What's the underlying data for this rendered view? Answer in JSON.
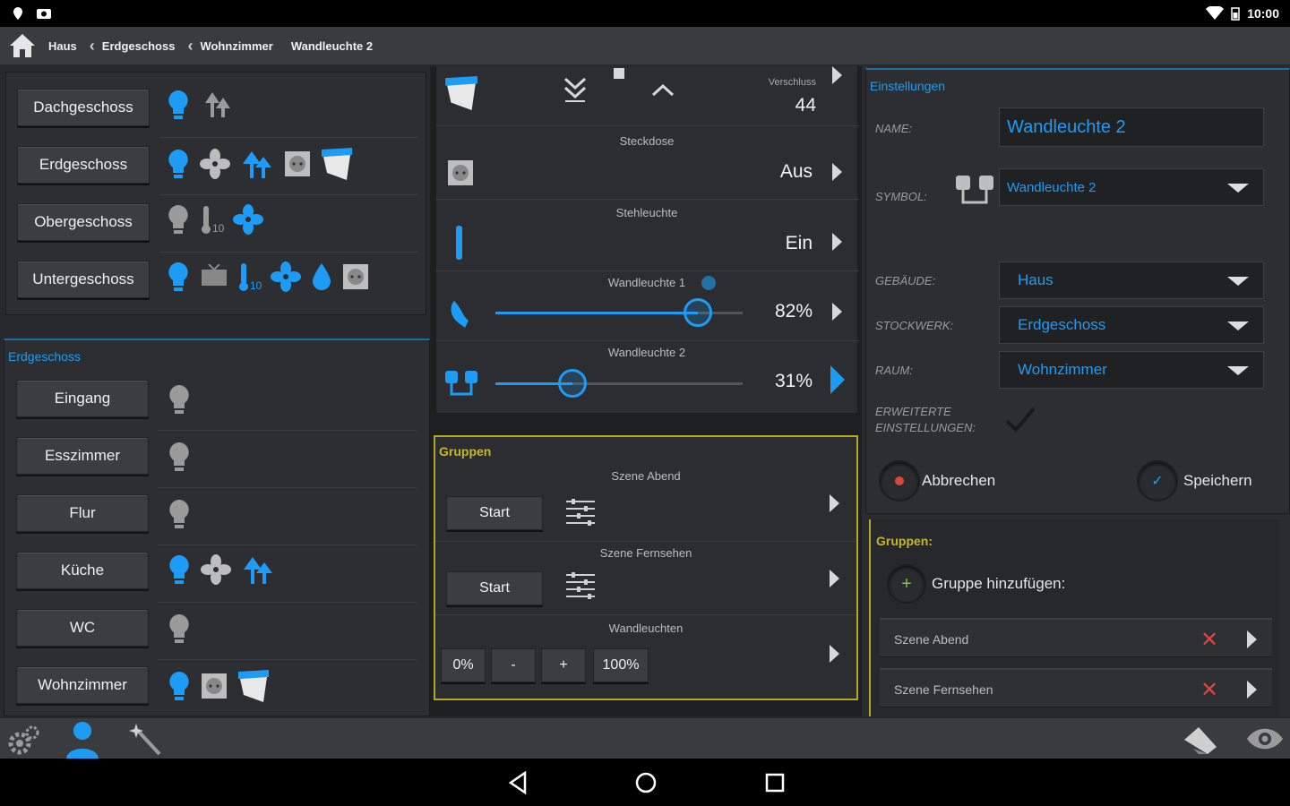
{
  "status": {
    "time": "10:00"
  },
  "breadcrumb": [
    "Haus",
    "Erdgeschoss",
    "Wohnzimmer",
    "Wandleuchte 2"
  ],
  "floors": [
    {
      "label": "Dachgeschoss"
    },
    {
      "label": "Erdgeschoss"
    },
    {
      "label": "Obergeschoss",
      "temp": "10"
    },
    {
      "label": "Untergeschoss",
      "temp": "10"
    }
  ],
  "rooms_title": "Erdgeschoss",
  "rooms": [
    {
      "label": "Eingang"
    },
    {
      "label": "Esszimmer"
    },
    {
      "label": "Flur"
    },
    {
      "label": "Küche"
    },
    {
      "label": "WC"
    },
    {
      "label": "Wohnzimmer"
    }
  ],
  "devices": {
    "shutter": {
      "label": "Verschluss",
      "value": "44"
    },
    "socket": {
      "label": "Steckdose",
      "value": "Aus"
    },
    "floorlamp": {
      "label": "Stehleuchte",
      "value": "Ein"
    },
    "wall1": {
      "label": "Wandleuchte 1",
      "value": "82%",
      "level": 0.82
    },
    "wall2": {
      "label": "Wandleuchte 2",
      "value": "31%",
      "level": 0.31
    }
  },
  "groups": {
    "title": "Gruppen",
    "items": [
      {
        "label": "Szene Abend",
        "button": "Start"
      },
      {
        "label": "Szene Fernsehen",
        "button": "Start"
      },
      {
        "label": "Wandleuchten",
        "buttons": [
          "0%",
          "-",
          "+",
          "100%"
        ]
      }
    ]
  },
  "settings": {
    "title": "Einstellungen",
    "name_label": "NAME:",
    "name_value": "Wandleuchte 2",
    "symbol_label": "SYMBOL:",
    "symbol_value": "Wandleuchte 2",
    "building_label": "GEBÄUDE:",
    "building_value": "Haus",
    "floor_label": "STOCKWERK:",
    "floor_value": "Erdgeschoss",
    "room_label": "RAUM:",
    "room_value": "Wohnzimmer",
    "advanced_label_1": "ERWEITERTE",
    "advanced_label_2": "EINSTELLUNGEN:",
    "cancel": "Abbrechen",
    "save": "Speichern"
  },
  "group_membership": {
    "title": "Gruppen:",
    "add_label": "Gruppe hinzufügen:",
    "items": [
      "Szene Abend",
      "Szene Fernsehen"
    ]
  },
  "colors": {
    "accent": "#1e9cf5",
    "group_border": "#b4a628",
    "remove": "#d9463e"
  }
}
